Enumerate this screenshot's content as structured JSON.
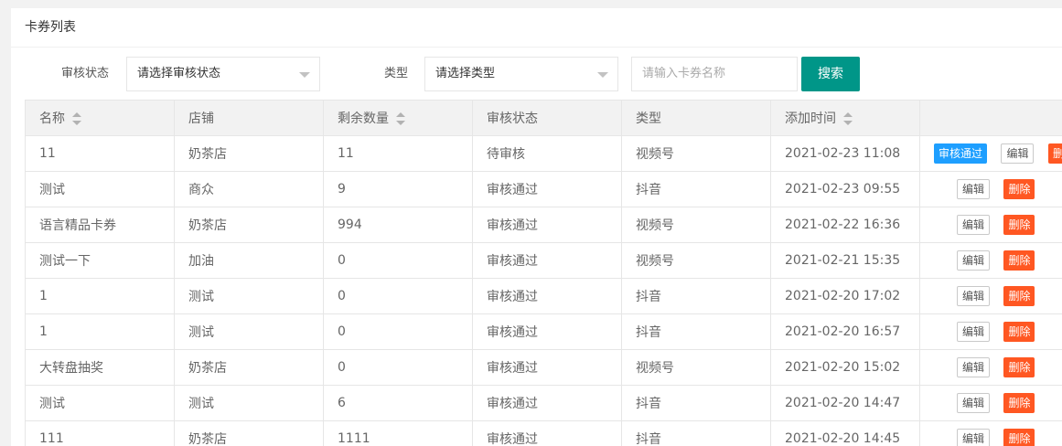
{
  "card": {
    "title": "卡券列表"
  },
  "filters": {
    "status_label": "审核状态",
    "status_select": "请选择审核状态",
    "type_label": "类型",
    "type_select": "请选择类型",
    "name_placeholder": "请输入卡券名称",
    "search_button": "搜索"
  },
  "table": {
    "headers": [
      "名称",
      "店铺",
      "剩余数量",
      "审核状态",
      "类型",
      "添加时间",
      ""
    ],
    "actions": {
      "approve": "审核通过",
      "edit": "编辑",
      "delete": "删除"
    },
    "rows": [
      {
        "name": "11",
        "shop": "奶茶店",
        "remaining": "11",
        "status": "待审核",
        "type": "视频号",
        "time": "2021-02-23 11:08"
      },
      {
        "name": "测试",
        "shop": "商众",
        "remaining": "9",
        "status": "审核通过",
        "type": "抖音",
        "time": "2021-02-23 09:55"
      },
      {
        "name": "语言精品卡券",
        "shop": "奶茶店",
        "remaining": "994",
        "status": "审核通过",
        "type": "视频号",
        "time": "2021-02-22 16:36"
      },
      {
        "name": "测试一下",
        "shop": "加油",
        "remaining": "0",
        "status": "审核通过",
        "type": "视频号",
        "time": "2021-02-21 15:35"
      },
      {
        "name": "1",
        "shop": "测试",
        "remaining": "0",
        "status": "审核通过",
        "type": "抖音",
        "time": "2021-02-20 17:02"
      },
      {
        "name": "1",
        "shop": "测试",
        "remaining": "0",
        "status": "审核通过",
        "type": "抖音",
        "time": "2021-02-20 16:57"
      },
      {
        "name": "大转盘抽奖",
        "shop": "奶茶店",
        "remaining": "0",
        "status": "审核通过",
        "type": "视频号",
        "time": "2021-02-20 15:02"
      },
      {
        "name": "测试",
        "shop": "测试",
        "remaining": "6",
        "status": "审核通过",
        "type": "抖音",
        "time": "2021-02-20 14:47"
      },
      {
        "name": "111",
        "shop": "奶茶店",
        "remaining": "1111",
        "status": "审核通过",
        "type": "抖音",
        "time": "2021-02-20 14:45"
      }
    ]
  },
  "colors": {
    "primary": "#009688",
    "danger": "#ff5722",
    "info": "#1e9fff"
  }
}
